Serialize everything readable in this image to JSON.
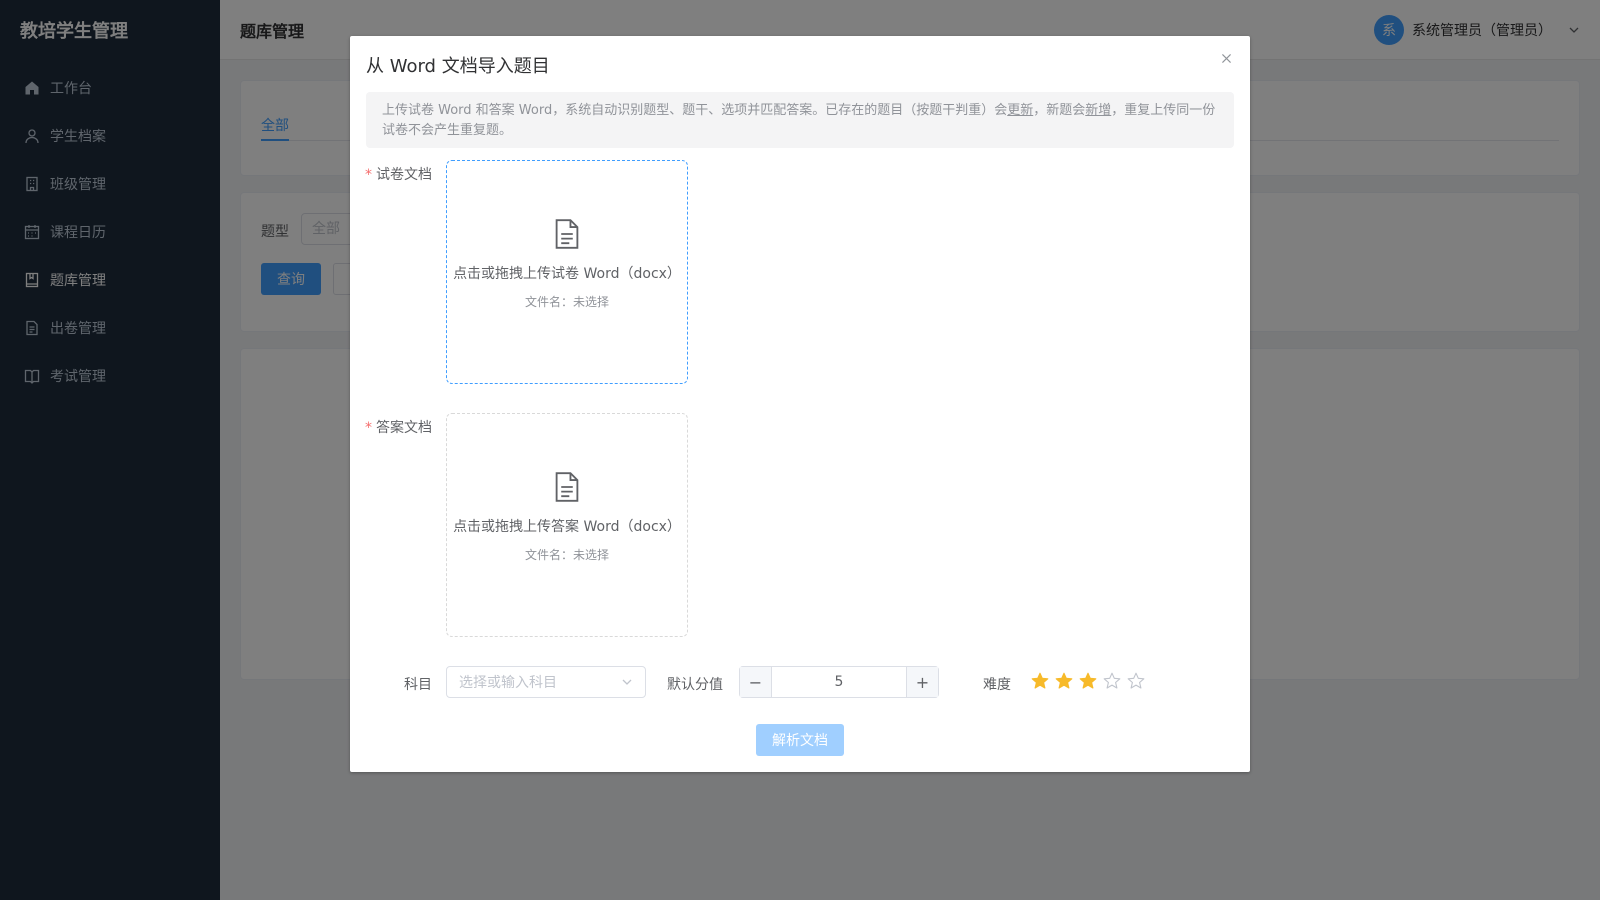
{
  "app": {
    "title": "教培学生管理"
  },
  "sidebar": {
    "items": [
      {
        "label": "工作台",
        "icon": "home-icon"
      },
      {
        "label": "学生档案",
        "icon": "user-icon"
      },
      {
        "label": "班级管理",
        "icon": "building-icon"
      },
      {
        "label": "课程日历",
        "icon": "calendar-icon"
      },
      {
        "label": "题库管理",
        "icon": "book-icon",
        "active": true
      },
      {
        "label": "出卷管理",
        "icon": "document-icon"
      },
      {
        "label": "考试管理",
        "icon": "open-book-icon"
      }
    ]
  },
  "header": {
    "title": "题库管理",
    "user": {
      "avatar_text": "系",
      "name": "系统管理员（管理员）"
    }
  },
  "main": {
    "tabs": [
      {
        "label": "全部"
      }
    ],
    "filter": {
      "type_label": "题型",
      "type_value": "全部",
      "query_label": "查询"
    }
  },
  "dialog": {
    "title": "从 Word 文档导入题目",
    "tip": {
      "part1": "上传试卷 Word 和答案 Word，系统自动识别题型、题干、选项并匹配答案。已存在的题目（按题干判重）会",
      "update": "更新",
      "part2": "，新题会",
      "add": "新增",
      "part3": "，重复上传同一份试卷不会产生重复题。"
    },
    "exam_doc": {
      "label": "试卷文档",
      "upload_text": "点击或拖拽上传试卷 Word（docx）",
      "file_name": "文件名：未选择"
    },
    "answer_doc": {
      "label": "答案文档",
      "upload_text": "点击或拖拽上传答案 Word（docx）",
      "file_name": "文件名：未选择"
    },
    "subject": {
      "label": "科目",
      "placeholder": "选择或输入科目"
    },
    "score": {
      "label": "默认分值",
      "value": "5",
      "minus": "−",
      "plus": "+"
    },
    "difficulty": {
      "label": "难度",
      "value": 3,
      "max": 5,
      "color_on": "#f7ba2a",
      "color_off": "#c0c4cc"
    },
    "parse_button": "解析文档"
  },
  "colors": {
    "primary": "#409eff",
    "sidebar_bg": "#1f2d3d",
    "required": "#f56c6c"
  }
}
